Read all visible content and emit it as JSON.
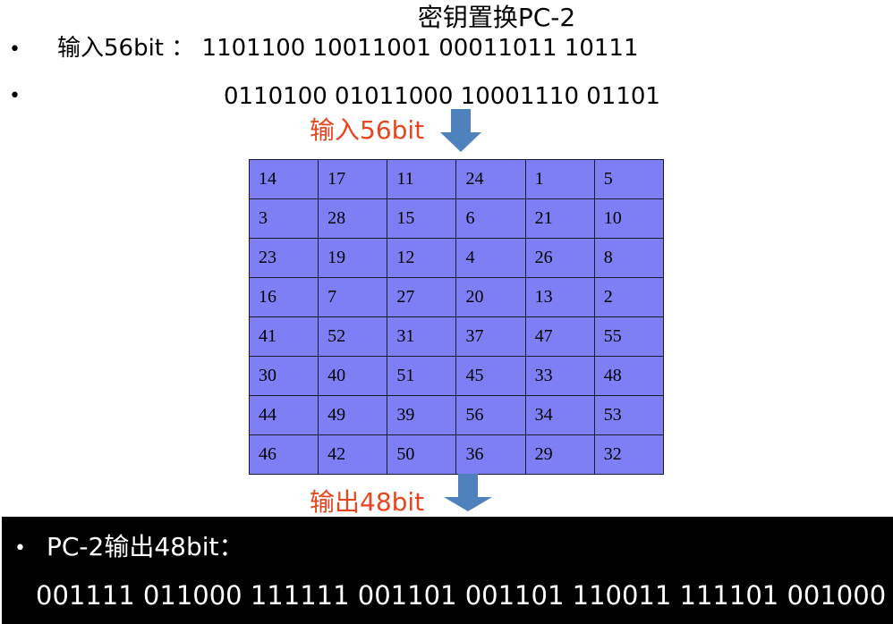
{
  "title": "密钥置换PC-2",
  "input": {
    "bullet": "•",
    "line1": "输入56bit ：  1101100 10011001 00011011 10111",
    "line2": "0110100 01011000 10001110 01101"
  },
  "labels": {
    "input56": "输入56bit",
    "output48": "输出48bit"
  },
  "table": [
    [
      "14",
      "17",
      "11",
      "24",
      "1",
      "5"
    ],
    [
      "3",
      "28",
      "15",
      "6",
      "21",
      "10"
    ],
    [
      "23",
      "19",
      "12",
      "4",
      "26",
      "8"
    ],
    [
      "16",
      "7",
      "27",
      "20",
      "13",
      "2"
    ],
    [
      "41",
      "52",
      "31",
      "37",
      "47",
      "55"
    ],
    [
      "30",
      "40",
      "51",
      "45",
      "33",
      "48"
    ],
    [
      "44",
      "49",
      "39",
      "56",
      "34",
      "53"
    ],
    [
      "46",
      "42",
      "50",
      "36",
      "29",
      "32"
    ]
  ],
  "output": {
    "bullet": "•",
    "heading": "PC-2输出48bit：",
    "bits": "001111 011000 111111 001101 001101 110011 111101 001000"
  },
  "colors": {
    "table_fill": "#7f7ff5",
    "arrow": "#4f81bd",
    "label_red": "#e8461f",
    "output_bg": "#000000"
  }
}
